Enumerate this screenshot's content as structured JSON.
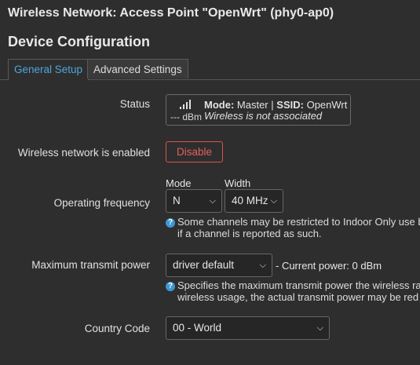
{
  "window": {
    "title": "Wireless Network: Access Point \"OpenWrt\" (phy0-ap0)"
  },
  "section": {
    "title": "Device Configuration"
  },
  "tabs": [
    {
      "label": "General Setup",
      "active": true
    },
    {
      "label": "Advanced Settings",
      "active": false
    }
  ],
  "status": {
    "label": "Status",
    "signal_icon": "signal-bars-icon",
    "dbm": "--- dBm",
    "mode_label": "Mode:",
    "mode_value": "Master",
    "separator": "|",
    "ssid_label": "SSID:",
    "ssid_value": "OpenWrt",
    "association": "Wireless is not associated"
  },
  "enabled": {
    "label": "Wireless network is enabled",
    "button": "Disable"
  },
  "frequency": {
    "label": "Operating frequency",
    "mode_header": "Mode",
    "width_header": "Width",
    "mode_value": "N",
    "width_value": "40 MHz",
    "help_line1": "Some channels may be restricted to Indoor Only use b",
    "help_line2": "if a channel is reported as such."
  },
  "txpower": {
    "label": "Maximum transmit power",
    "value": "driver default",
    "current": "- Current power: 0 dBm",
    "help_line1": "Specifies the maximum transmit power the wireless ra",
    "help_line2": "wireless usage, the actual transmit power may be red"
  },
  "country": {
    "label": "Country Code",
    "value": "00 - World"
  },
  "colors": {
    "accent": "#4ea6dc",
    "danger": "#d9534f",
    "background": "#2e2e2e"
  }
}
